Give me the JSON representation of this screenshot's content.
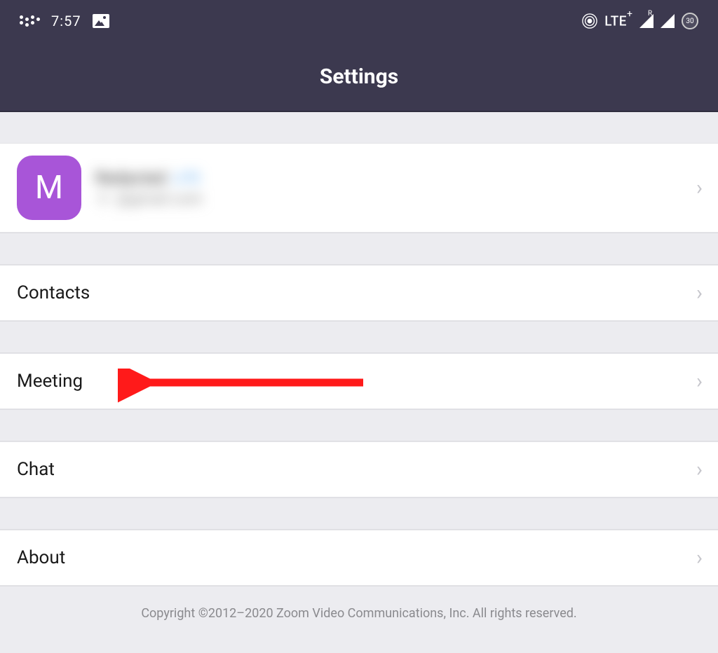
{
  "status": {
    "time": "7:57",
    "network": "LTE",
    "network_plus": "+",
    "roaming_label": "R",
    "battery": "30"
  },
  "header": {
    "title": "Settings"
  },
  "profile": {
    "avatar_letter": "M",
    "name": "Redacted",
    "badge": "LITE",
    "email_domain": "@gmail.com"
  },
  "menu": {
    "contacts": "Contacts",
    "meeting": "Meeting",
    "chat": "Chat",
    "about": "About"
  },
  "footer": {
    "copyright": "Copyright ©2012–2020 Zoom Video Communications, Inc. All rights reserved."
  }
}
